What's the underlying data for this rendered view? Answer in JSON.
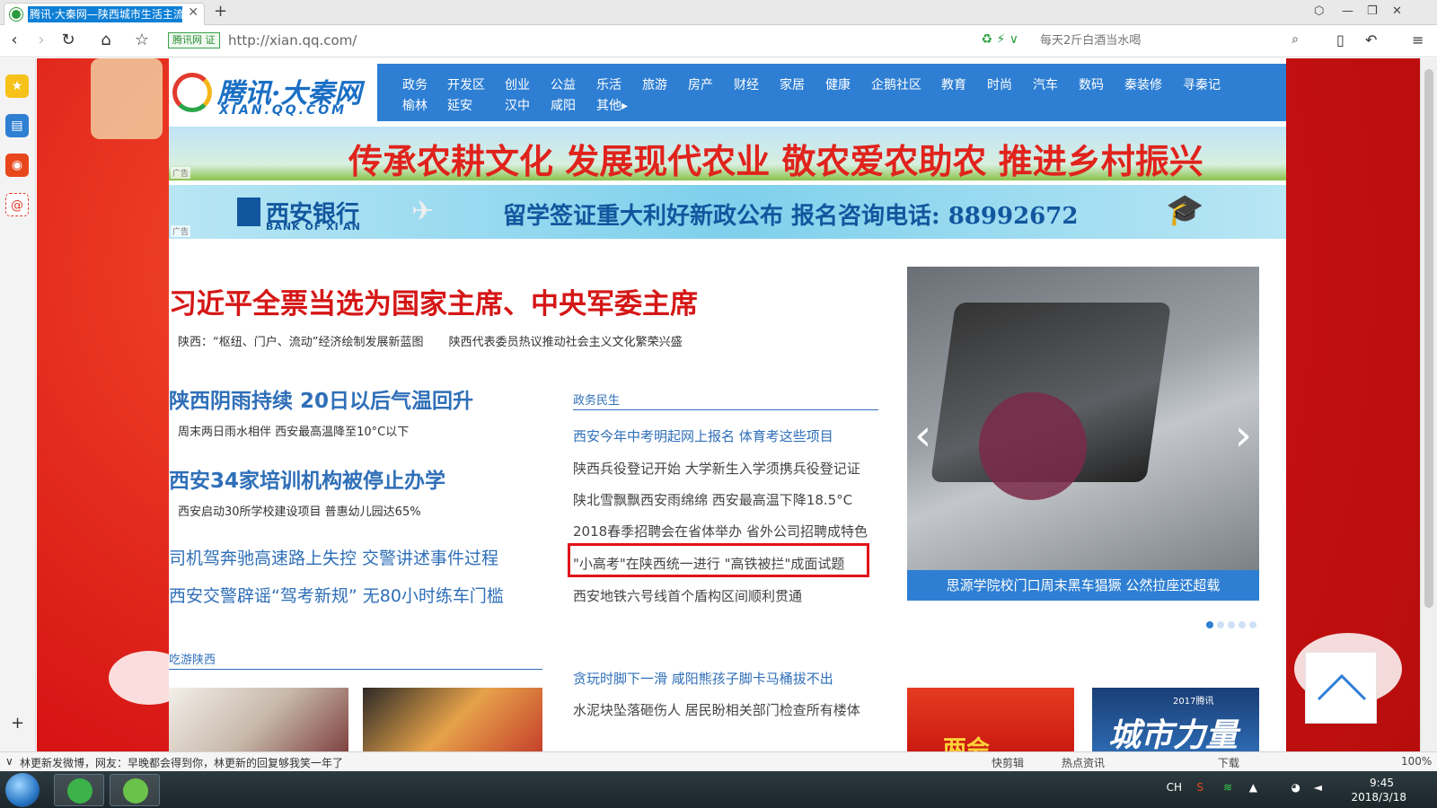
{
  "browser": {
    "tab_title": "腾讯·大秦网—陕西城市生活主流",
    "tab_close": "✕",
    "new_tab": "+",
    "secure_label": "腾讯网 证",
    "url": "http://xian.qq.com/",
    "search_placeholder": "每天2斤白酒当水喝",
    "colors": {
      "tab_highlight": "#0e7fd6",
      "secure_green": "#2a8a35"
    }
  },
  "logo": {
    "name": "腾讯·大秦网",
    "domain": "XIAN.QQ.COM"
  },
  "nav": {
    "row1": [
      "政务",
      "开发区",
      "创业",
      "公益",
      "乐活",
      "旅游",
      "房产",
      "财经",
      "家居",
      "健康",
      "企鹅社区",
      "教育",
      "时尚",
      "汽车",
      "数码",
      "秦装修",
      "寻秦记"
    ],
    "row2": [
      "榆林",
      "延安",
      "汉中",
      "咸阳",
      "其他▸"
    ]
  },
  "banners": {
    "ad_label": "广告",
    "banner1_text": "传承农耕文化  发展现代农业  敬农爱农助农  推进乡村振兴",
    "bank_name": "西安银行",
    "bank_en": "BANK OF XI'AN",
    "banner2_text": "留学签证重大利好新政公布  报名咨询电话: 88992672"
  },
  "headline": {
    "title": "习近平全票当选为国家主席、中央军委主席",
    "sub1": "陕西：“枢纽、门户、流动”经济绘制发展新蓝图",
    "sub2": "陕西代表委员热议推动社会主义文化繁荣兴盛"
  },
  "leads": [
    {
      "title": "陕西阴雨持续 20日以后气温回升",
      "sub": "周末两日雨水相伴 西安最高温降至10°C以下"
    },
    {
      "title": "西安34家培训机构被停止办学",
      "sub": "西安启动30所学校建设项目 普惠幼儿园达65%"
    }
  ],
  "lead_links": [
    "司机驾奔驰高速路上失控 交警讲述事件过程",
    "西安交警辟谣“驾考新规” 无80小时练车门槛"
  ],
  "section_politics": {
    "heading": "政务民生",
    "items": [
      "西安今年中考明起网上报名 体育考这些项目",
      "陕西兵役登记开始 大学新生入学须携兵役登记证",
      "陕北雪飘飘西安雨绵绵 西安最高温下降18.5°C",
      "2018春季招聘会在省体举办 省外公司招聘成特色",
      "\"小高考\"在陕西统一进行 \"高铁被拦\"成面试题",
      "西安地铁六号线首个盾构区间顺利贯通"
    ]
  },
  "slider": {
    "caption": "思源学院校门口周末黑车猖獗 公然拉座还超载",
    "prev": "‹",
    "next": "›",
    "dots_total": 5,
    "dot_active": 1
  },
  "section_food": {
    "heading": "吃游陕西"
  },
  "more_news": [
    "贪玩时脚下一滑 咸阳熊孩子脚卡马桶拔不出",
    "水泥块坠落砸伤人 居民盼相关部门检查所有楼体"
  ],
  "thumbs": {
    "thumb3_text": "两会",
    "thumb4_year": "2017腾讯",
    "thumb4_text": "城市力量"
  },
  "statusbar": {
    "ticker": "林更新发微博，网友：早晚都会得到你，林更新的回复够我笑一年了",
    "items": [
      "快剪辑",
      "热点资讯",
      "下载",
      "100%"
    ]
  },
  "taskbar": {
    "lang": "CH",
    "time": "9:45",
    "date": "2018/3/18"
  }
}
